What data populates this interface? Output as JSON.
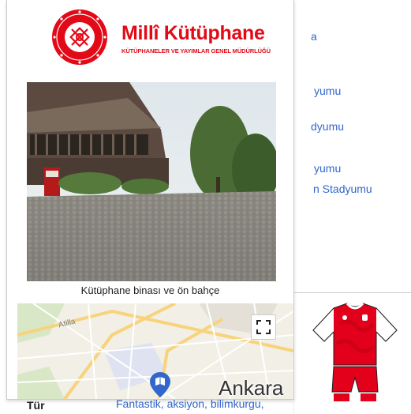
{
  "background": {
    "links": [
      "a",
      "yumu",
      "dyumu",
      "yumu",
      "n Stadyumu"
    ],
    "bottom_label": "Tür",
    "bottom_value": "Fantastik, aksiyon, bilimkurgu,"
  },
  "popup": {
    "logo_title": "Millî Kütüphane",
    "logo_subtitle": "KÜTÜPHANELER VE YAYIMLAR GENEL MÜDÜRLÜĞÜ",
    "photo_caption": "Kütüphane binası ve ön bahçe",
    "map": {
      "city_label": "Ankara",
      "street_label": "Atilla"
    }
  },
  "colors": {
    "brand_red": "#e30a17",
    "link_blue": "#3366cc",
    "pin_blue": "#3366cc"
  },
  "icons": [
    "fullscreen-icon",
    "map-pin-icon",
    "ministry-seal-logo",
    "football-kit-image"
  ]
}
